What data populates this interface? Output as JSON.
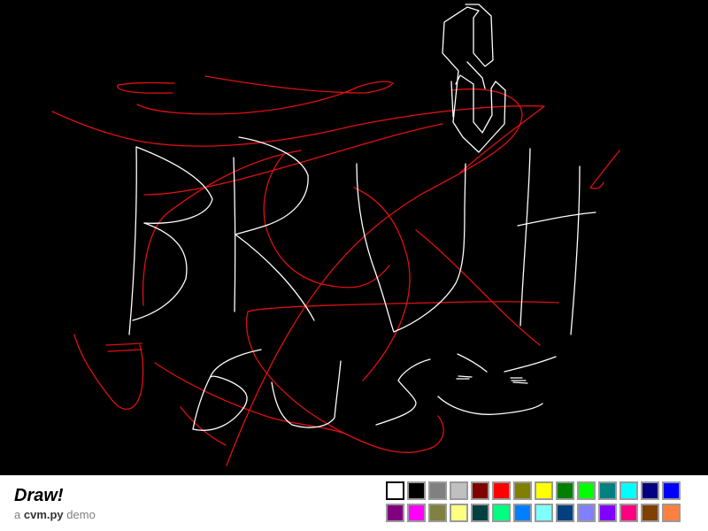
{
  "app": {
    "title": "Draw!",
    "subtitle_prefix": "a",
    "subtitle_brand": "cvm.py",
    "subtitle_suffix": "demo"
  },
  "palette": {
    "selected_index": 0,
    "colors": [
      "#ffffff",
      "#000000",
      "#808080",
      "#c0c0c0",
      "#800000",
      "#ff0000",
      "#808000",
      "#ffff00",
      "#008000",
      "#00ff00",
      "#008080",
      "#00ffff",
      "#000080",
      "#0000ff",
      "#800080",
      "#ff00ff",
      "#808040",
      "#ffff80",
      "#004040",
      "#00ff80",
      "#0080ff",
      "#80ffff",
      "#004080",
      "#8080ff",
      "#8000ff",
      "#ff0080",
      "#804000",
      "#ff8040"
    ]
  },
  "drawing": {
    "stroke_colors": {
      "white": "#ffffff",
      "red": "#e01010"
    },
    "description_text": "BRUH SUS"
  }
}
